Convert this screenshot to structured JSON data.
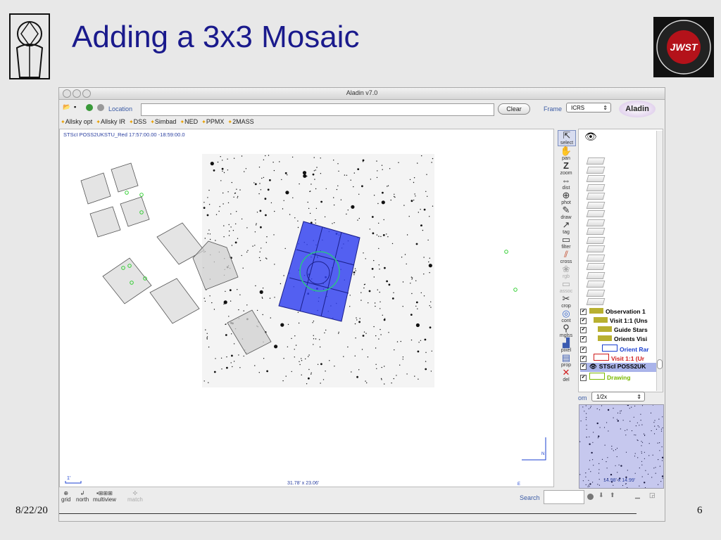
{
  "slide": {
    "title": "Adding a 3x3 Mosaic",
    "date": "8/22/20",
    "page_number": "6",
    "logo_left": "jwst-mirror-emblem",
    "logo_right": "James Webb Space Telescope JWST NASA ESA CSA"
  },
  "app": {
    "window_title": "Aladin v7.0",
    "location_label": "Location",
    "location_value": "",
    "clear_label": "Clear",
    "frame_label": "Frame",
    "frame_value": "ICRS",
    "brand": "Aladin",
    "quick_surveys": [
      "Allsky opt",
      "Allsky IR",
      "DSS",
      "Simbad",
      "NED",
      "PPMX",
      "2MASS"
    ],
    "image_label": "STScI POSS2UKSTU_Red 17:57:00.00 -18:59:00.0",
    "scale_label": "1'",
    "fov_label": "31.78' x 23.06'",
    "compass_n": "N",
    "compass_e": "E",
    "tools": [
      {
        "label": "select",
        "icon": "arrow-icon"
      },
      {
        "label": "pan",
        "icon": "hand-icon"
      },
      {
        "label": "zoom",
        "icon": "zoom-icon"
      },
      {
        "label": "dist",
        "icon": "distance-icon"
      },
      {
        "label": "phot",
        "icon": "photometry-icon"
      },
      {
        "label": "draw",
        "icon": "pencil-icon"
      },
      {
        "label": "tag",
        "icon": "tag-icon"
      },
      {
        "label": "filter",
        "icon": "filter-icon"
      },
      {
        "label": "cross",
        "icon": "cross-icon"
      },
      {
        "label": "rgb",
        "icon": "rgb-icon"
      },
      {
        "label": "assoc",
        "icon": "assoc-icon"
      },
      {
        "label": "crop",
        "icon": "scissors-icon"
      },
      {
        "label": "cont",
        "icon": "contour-icon"
      },
      {
        "label": "mglss",
        "icon": "magnifier-icon"
      },
      {
        "label": "pixel",
        "icon": "pixel-icon"
      },
      {
        "label": "prop",
        "icon": "properties-icon"
      },
      {
        "label": "del",
        "icon": "delete-icon"
      }
    ],
    "layers": [
      {
        "label": "Observation 1",
        "color": "#000000"
      },
      {
        "label": "Visit 1:1 (Uns",
        "color": "#000000"
      },
      {
        "label": "Guide Stars",
        "color": "#000000"
      },
      {
        "label": "Orients Visi",
        "color": "#000000"
      },
      {
        "label": "Orient Rar",
        "color": "#1a3fd0"
      },
      {
        "label": "Visit 1:1 (Ur",
        "color": "#d01a1a"
      },
      {
        "label": "STScI POSS2UK",
        "color": "#000000"
      },
      {
        "label": "Drawing",
        "color": "#7ab800"
      }
    ],
    "zoom_label_prefix": "om",
    "zoom_value": "1/2x",
    "zoom_fov": "14.98' x 14.99'",
    "footer_tools": [
      "grid",
      "north",
      "multiview",
      "match"
    ],
    "search_label": "Search",
    "search_value": "",
    "colors": {
      "mosaic_fill": "#2f3ff0",
      "overlay_green": "#22cc22",
      "accent_blue": "#3b5ba5"
    }
  }
}
